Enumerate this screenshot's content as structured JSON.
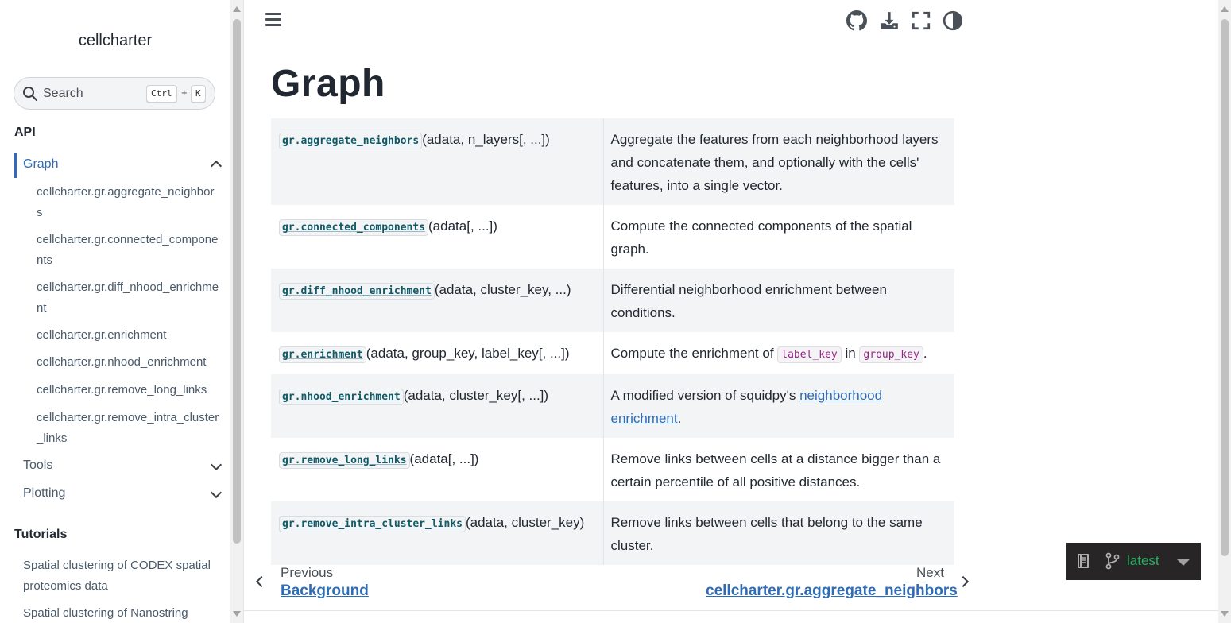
{
  "sidebar": {
    "brand": "cellcharter",
    "search": {
      "placeholder": "Search",
      "key1": "Ctrl",
      "plus": "+",
      "key2": "K"
    },
    "api_caption": "API",
    "active_section": "Graph",
    "graph_items": [
      "cellcharter.gr.aggregate_neighbors",
      "cellcharter.gr.connected_components",
      "cellcharter.gr.diff_nhood_enrichment",
      "cellcharter.gr.enrichment",
      "cellcharter.gr.nhood_enrichment",
      "cellcharter.gr.remove_long_links",
      "cellcharter.gr.remove_intra_cluster_links"
    ],
    "tools_label": "Tools",
    "plotting_label": "Plotting",
    "tutorials_caption": "Tutorials",
    "tutorials": [
      "Spatial clustering of CODEX spatial proteomics data",
      "Spatial clustering of Nanostring"
    ]
  },
  "main": {
    "title": "Graph",
    "rows": [
      {
        "fn": "gr.aggregate_neighbors",
        "args": "(adata, n_layers[, ...])",
        "desc": "Aggregate the features from each neighborhood layers and concatenate them, and optionally with the cells' features, into a single vector."
      },
      {
        "fn": "gr.connected_components",
        "args": "(adata[, ...])",
        "desc": "Compute the connected components of the spatial graph."
      },
      {
        "fn": "gr.diff_nhood_enrichment",
        "args": "(adata, cluster_key, ...)",
        "desc": "Differential neighborhood enrichment between conditions."
      },
      {
        "fn": "gr.enrichment",
        "args": "(adata, group_key, label_key[, ...])",
        "desc_pre": "Compute the enrichment of ",
        "code1": "label_key",
        "desc_mid": " in ",
        "code2": "group_key",
        "desc_post": "."
      },
      {
        "fn": "gr.nhood_enrichment",
        "args": "(adata, cluster_key[, ...])",
        "desc_pre": "A modified version of squidpy's ",
        "link": "neighborhood enrichment",
        "desc_post": "."
      },
      {
        "fn": "gr.remove_long_links",
        "args": "(adata[, ...])",
        "desc": "Remove links between cells at a distance bigger than a certain percentile of all positive distances."
      },
      {
        "fn": "gr.remove_intra_cluster_links",
        "args": "(adata, cluster_key)",
        "desc": "Remove links between cells that belong to the same cluster."
      }
    ],
    "prev": {
      "label": "Previous",
      "title": "Background"
    },
    "next": {
      "label": "Next",
      "title": "cellcharter.gr.aggregate_neighbors"
    }
  },
  "header_icons": [
    "menu-icon",
    "github-icon",
    "download-icon",
    "fullscreen-icon",
    "theme-toggle-icon"
  ],
  "flyout": {
    "version": "latest"
  },
  "colors": {
    "accent": "#2f6cb5",
    "version_green": "#27ae60",
    "code_fn": "#0f5a66",
    "code_literal": "#912583"
  }
}
